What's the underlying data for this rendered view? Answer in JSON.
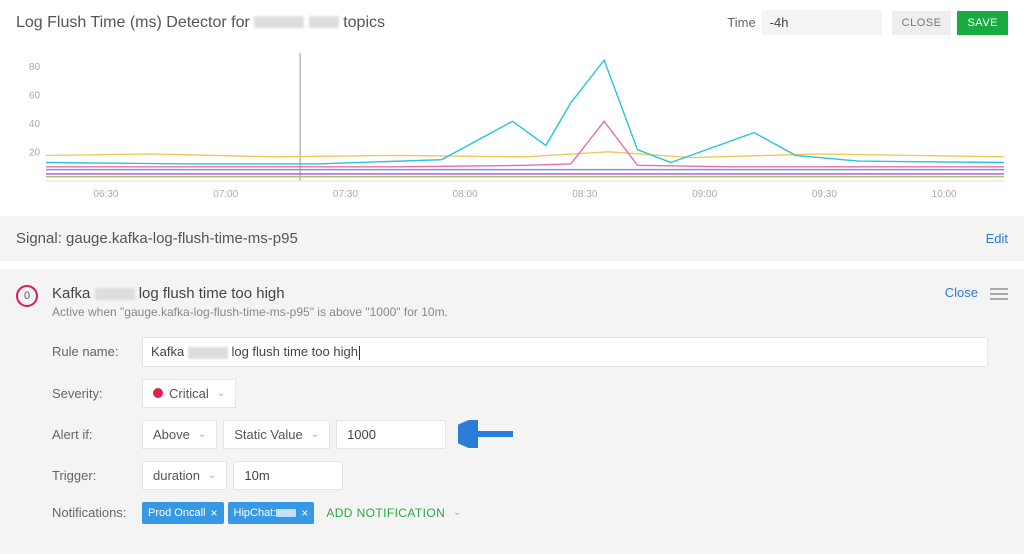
{
  "header": {
    "title_pre": "Log Flush Time (ms) Detector for ",
    "title_post": " topics",
    "time_label": "Time",
    "time_value": "-4h",
    "close": "CLOSE",
    "save": "SAVE"
  },
  "chart_data": {
    "type": "line",
    "xlabel": "",
    "ylabel": "",
    "ylim": [
      0,
      90
    ],
    "x_ticks": [
      "06:30",
      "07:00",
      "07:30",
      "08:00",
      "08:30",
      "09:00",
      "09:30",
      "10:00"
    ],
    "y_ticks": [
      20,
      40,
      60,
      80
    ],
    "x_range_minutes": [
      375,
      605
    ],
    "cursor_x_minute": 436,
    "series": [
      {
        "name": "s1",
        "color": "#f2c85b",
        "points": [
          [
            375,
            18
          ],
          [
            400,
            19
          ],
          [
            430,
            17
          ],
          [
            460,
            18
          ],
          [
            490,
            17
          ],
          [
            510,
            20.5
          ],
          [
            530,
            16.5
          ],
          [
            560,
            19
          ],
          [
            605,
            17
          ]
        ]
      },
      {
        "name": "s2",
        "color": "#26c6da",
        "points": [
          [
            375,
            13
          ],
          [
            410,
            12
          ],
          [
            440,
            12
          ],
          [
            470,
            15
          ],
          [
            487,
            42
          ],
          [
            495,
            25
          ],
          [
            501,
            55
          ],
          [
            509,
            85
          ],
          [
            517,
            22
          ],
          [
            525,
            13
          ],
          [
            545,
            34
          ],
          [
            555,
            18
          ],
          [
            570,
            14
          ],
          [
            605,
            13
          ]
        ]
      },
      {
        "name": "s3",
        "color": "#e66fa8",
        "points": [
          [
            375,
            10
          ],
          [
            460,
            10
          ],
          [
            490,
            11
          ],
          [
            501,
            12
          ],
          [
            509,
            42
          ],
          [
            517,
            11
          ],
          [
            540,
            10
          ],
          [
            605,
            10
          ]
        ]
      },
      {
        "name": "s4",
        "color": "#7e8ff0",
        "points": [
          [
            375,
            8
          ],
          [
            605,
            8
          ]
        ]
      },
      {
        "name": "s5",
        "color": "#b94bd1",
        "points": [
          [
            375,
            5
          ],
          [
            605,
            5
          ]
        ]
      },
      {
        "name": "s6",
        "color": "#9ccc65",
        "points": [
          [
            375,
            3
          ],
          [
            605,
            3
          ]
        ]
      }
    ]
  },
  "signal": {
    "label": "Signal: gauge.kafka-log-flush-time-ms-p95",
    "edit": "Edit"
  },
  "rule": {
    "badge": "0",
    "title_pre": "Kafka ",
    "title_post": " log flush time too high",
    "subtitle": "Active when \"gauge.kafka-log-flush-time-ms-p95\" is above \"1000\" for 10m.",
    "close": "Close",
    "form": {
      "name_label": "Rule name:",
      "name_pre": "Kafka ",
      "name_post": " log flush time too high",
      "severity_label": "Severity:",
      "severity_value": "Critical",
      "alertif_label": "Alert if:",
      "direction": "Above",
      "mode": "Static Value",
      "threshold": "1000",
      "trigger_label": "Trigger:",
      "trigger_mode": "duration",
      "trigger_value": "10m",
      "notifications_label": "Notifications:",
      "notif1": "Prod Oncall",
      "notif2_pre": "HipChat: ",
      "add_notification": "ADD NOTIFICATION"
    }
  }
}
